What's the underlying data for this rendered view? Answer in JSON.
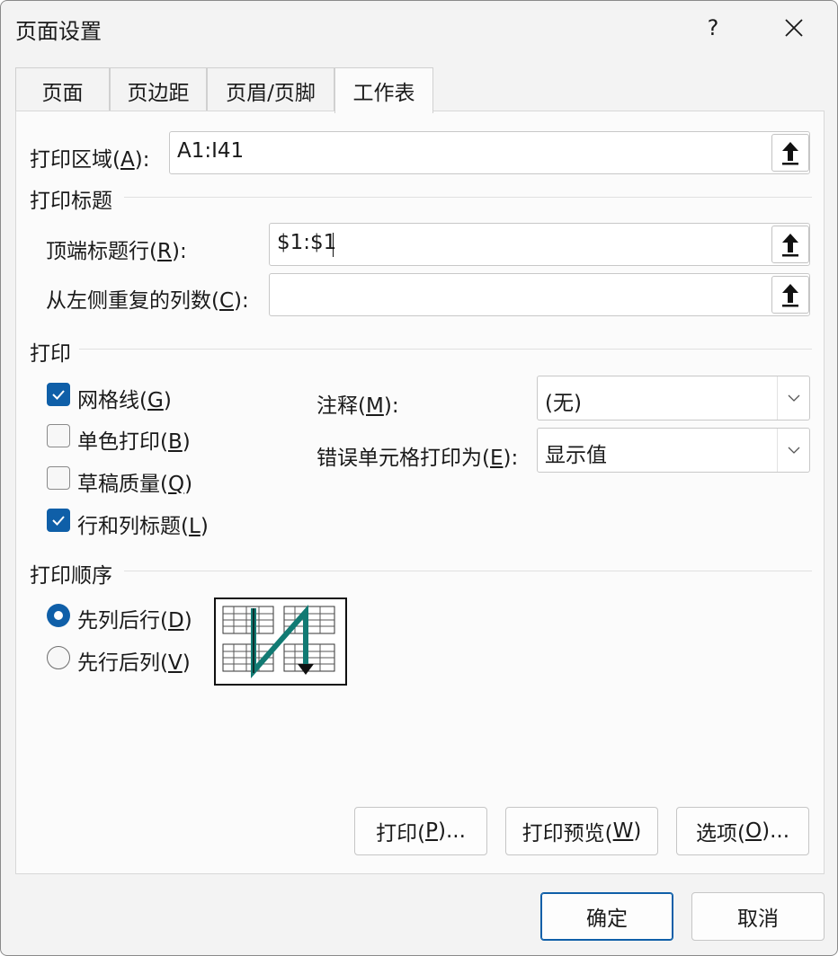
{
  "window": {
    "title": "页面设置",
    "help": "?",
    "close_icon": "close-icon"
  },
  "tabs": [
    {
      "label": "页面",
      "active": false
    },
    {
      "label": "页边距",
      "active": false
    },
    {
      "label": "页眉/页脚",
      "active": false
    },
    {
      "label": "工作表",
      "active": true
    }
  ],
  "print_area": {
    "label": "打印区域(",
    "mnemonic": "A",
    "suffix": "):",
    "value": "A1:I41",
    "button_icon": "collapse-arrow-up-icon"
  },
  "print_titles": {
    "heading": "打印标题",
    "rows": {
      "label": "顶端标题行(",
      "mnemonic": "R",
      "suffix": "):",
      "value": "$1:$1"
    },
    "columns": {
      "label": "从左侧重复的列数(",
      "mnemonic": "C",
      "suffix": "):",
      "value": ""
    }
  },
  "print": {
    "heading": "打印",
    "gridlines": {
      "label": "网格线(",
      "mnemonic": "G",
      "suffix": ")",
      "checked": true
    },
    "bw": {
      "label": "单色打印(",
      "mnemonic": "B",
      "suffix": ")",
      "checked": false
    },
    "draft": {
      "label": "草稿质量(",
      "mnemonic": "Q",
      "suffix": ")",
      "checked": false
    },
    "headings": {
      "label": "行和列标题(",
      "mnemonic": "L",
      "suffix": ")",
      "checked": true
    },
    "comments": {
      "label": "注释(",
      "mnemonic": "M",
      "suffix": "):",
      "value": "(无)"
    },
    "errors": {
      "label": "错误单元格打印为(",
      "mnemonic": "E",
      "suffix": "):",
      "value": "显示值"
    }
  },
  "page_order": {
    "heading": "打印顺序",
    "down_then_over": {
      "label": "先列后行(",
      "mnemonic": "D",
      "suffix": ")",
      "selected": true
    },
    "over_then_down": {
      "label": "先行后列(",
      "mnemonic": "V",
      "suffix": ")",
      "selected": false
    }
  },
  "panel_buttons": {
    "print": {
      "label": "打印(",
      "mnemonic": "P",
      "suffix": ")..."
    },
    "preview": {
      "label": "打印预览(",
      "mnemonic": "W",
      "suffix": ")"
    },
    "options": {
      "label": "选项(",
      "mnemonic": "O",
      "suffix": ")..."
    }
  },
  "footer": {
    "ok": "确定",
    "cancel": "取消"
  },
  "colors": {
    "accent": "#0f5fa8",
    "order_arrow": "#117a73"
  }
}
